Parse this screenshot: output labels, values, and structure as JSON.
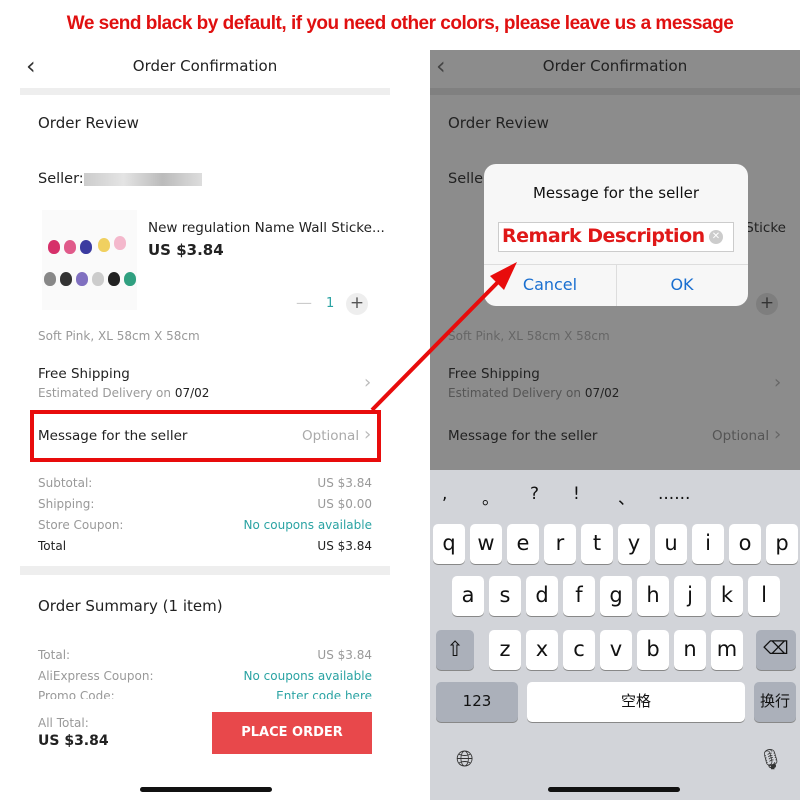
{
  "banner": "We send black by default, if you need other colors, please leave us a message",
  "colors": {
    "accent_red": "#e8484b",
    "teal": "#2aa3a3",
    "annotation_red": "#e80c0c",
    "ios_blue": "#1a6fd0"
  },
  "header": {
    "back_icon": "chevron-left-icon",
    "title": "Order Confirmation"
  },
  "order_review": {
    "title": "Order Review",
    "seller_label": "Seller:",
    "product": {
      "name": "New regulation Name Wall Sticke...",
      "price": "US $3.84",
      "quantity": "1",
      "variant": "Soft Pink, XL 58cm X 58cm"
    },
    "shipping": {
      "title": "Free Shipping",
      "delivery_label": "Estimated Delivery on",
      "delivery_date": "07/02"
    },
    "message": {
      "label": "Message for the seller",
      "placeholder": "Optional"
    },
    "subtotal": {
      "label": "Subtotal:",
      "value": "US $3.84"
    },
    "shipping_cost": {
      "label": "Shipping:",
      "value": "US $0.00"
    },
    "store_coupon": {
      "label": "Store Coupon:",
      "value": "No coupons available"
    },
    "total": {
      "label": "Total",
      "value": "US $3.84"
    }
  },
  "order_summary": {
    "title": "Order Summary (1 item)",
    "total": {
      "label": "Total:",
      "value": "US $3.84"
    },
    "aliexpress_coupon": {
      "label": "AliExpress Coupon:",
      "value": "No coupons available"
    },
    "promo_code": {
      "label": "Promo Code:",
      "value": "Enter code here"
    }
  },
  "footer": {
    "all_total_label": "All Total:",
    "all_total_value": "US $3.84",
    "place_order": "PLACE ORDER"
  },
  "dialog": {
    "title": "Message for the seller",
    "input_value": "Remark Description",
    "cancel": "Cancel",
    "ok": "OK"
  },
  "keyboard": {
    "symbols": [
      ",",
      "。",
      "?",
      "!",
      "、",
      "......"
    ],
    "row1": [
      "q",
      "w",
      "e",
      "r",
      "t",
      "y",
      "u",
      "i",
      "o",
      "p"
    ],
    "row2": [
      "a",
      "s",
      "d",
      "f",
      "g",
      "h",
      "j",
      "k",
      "l"
    ],
    "row3": [
      "z",
      "x",
      "c",
      "v",
      "b",
      "n",
      "m"
    ],
    "numbers": "123",
    "space": "空格",
    "return": "换行"
  }
}
